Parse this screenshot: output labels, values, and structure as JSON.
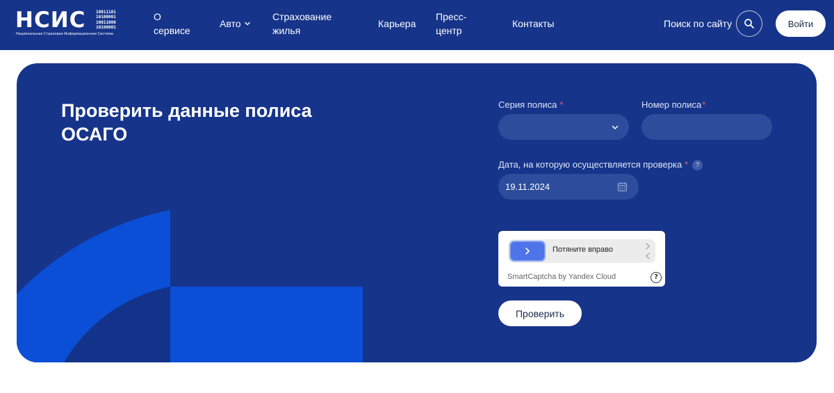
{
  "header": {
    "logo": {
      "main": "НСИС",
      "binary": [
        "10011101",
        "10100001",
        "10011000",
        "10100001"
      ],
      "subtitle": "Национальная Страховая Информационная Система"
    },
    "nav": [
      {
        "label": "О сервисе"
      },
      {
        "label": "Авто",
        "dropdown": true,
        "icon": "chevron-down-icon"
      },
      {
        "label": "Страхование жилья"
      },
      {
        "label": "Карьера"
      },
      {
        "label": "Пресс-центр"
      },
      {
        "label": "Контакты"
      }
    ],
    "search_label": "Поиск по сайту",
    "search_icon": "search-icon",
    "login_label": "Войти"
  },
  "form": {
    "title": "Проверить данные полиса ОСАГО",
    "series_label": "Серия полиса",
    "series_value": "",
    "number_label": "Номер полиса",
    "number_value": "",
    "date_label": "Дата, на которую осуществляется проверка",
    "date_value": "19.11.2024",
    "required_mark": "*",
    "help_mark": "?",
    "captcha": {
      "slider_text": "Потяните вправо",
      "brand": "SmartCaptcha by Yandex Cloud",
      "help": "?"
    },
    "submit_label": "Проверить"
  },
  "colors": {
    "header_bg": "#16348a",
    "card_bg": "#16348a",
    "field_bg": "#2d4d9c",
    "deco_bright": "#0b4fd6",
    "deco_dark": "#13338a",
    "slider_knob": "#4f73e8",
    "required": "#e35f6b"
  }
}
